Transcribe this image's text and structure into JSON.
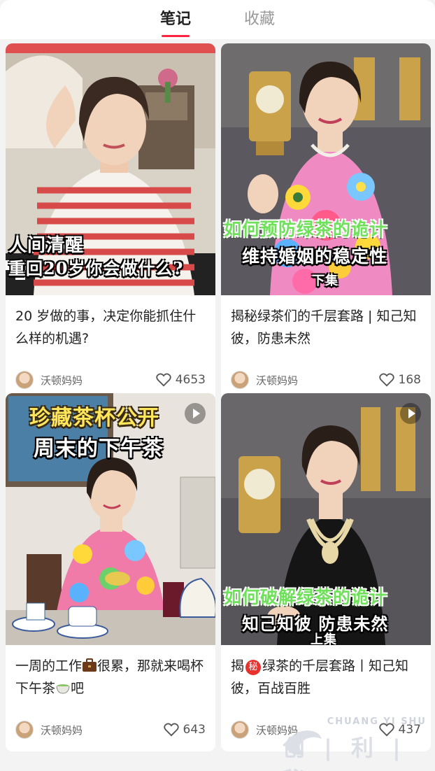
{
  "tabs": [
    {
      "label": "笔记",
      "active": true
    },
    {
      "label": "收藏",
      "active": false
    }
  ],
  "notes": [
    {
      "cover_lines": [
        "人间清醒",
        "重回20岁你会做什么?"
      ],
      "title": "20 岁做的事，决定你能抓住什么样的机遇?",
      "author": "沃顿妈妈",
      "likes": "4653",
      "video": false
    },
    {
      "cover_lines": [
        "如何预防绿茶的诡计",
        "维持婚姻的稳定性",
        "下集"
      ],
      "title": "揭秘绿茶们的千层套路 | 知己知彼，防患未然",
      "author": "沃顿妈妈",
      "likes": "168",
      "video": false
    },
    {
      "cover_lines": [
        "珍藏茶杯公开",
        "周末的下午茶"
      ],
      "title_parts": [
        "一周的工作",
        "很累，那就来喝杯下午茶",
        "吧"
      ],
      "title_icons": [
        "briefcase-icon",
        "tea-cup-icon"
      ],
      "author": "沃顿妈妈",
      "likes": "643",
      "video": true
    },
    {
      "cover_lines": [
        "如何破解绿茶的诡计",
        "知己知彼 防患未然",
        "上集"
      ],
      "title_parts": [
        "揭",
        "秘",
        "绿茶的千层套路丨知己知彼，百战百胜"
      ],
      "author": "沃顿妈妈",
      "likes": "437",
      "video": true
    }
  ],
  "watermark": {
    "top": "CHUANG YI SHU",
    "bottom": "创 | 利 | 秘"
  },
  "colors": {
    "accent": "#ff2442",
    "background": "#f3f3f3",
    "card": "#ffffff"
  }
}
